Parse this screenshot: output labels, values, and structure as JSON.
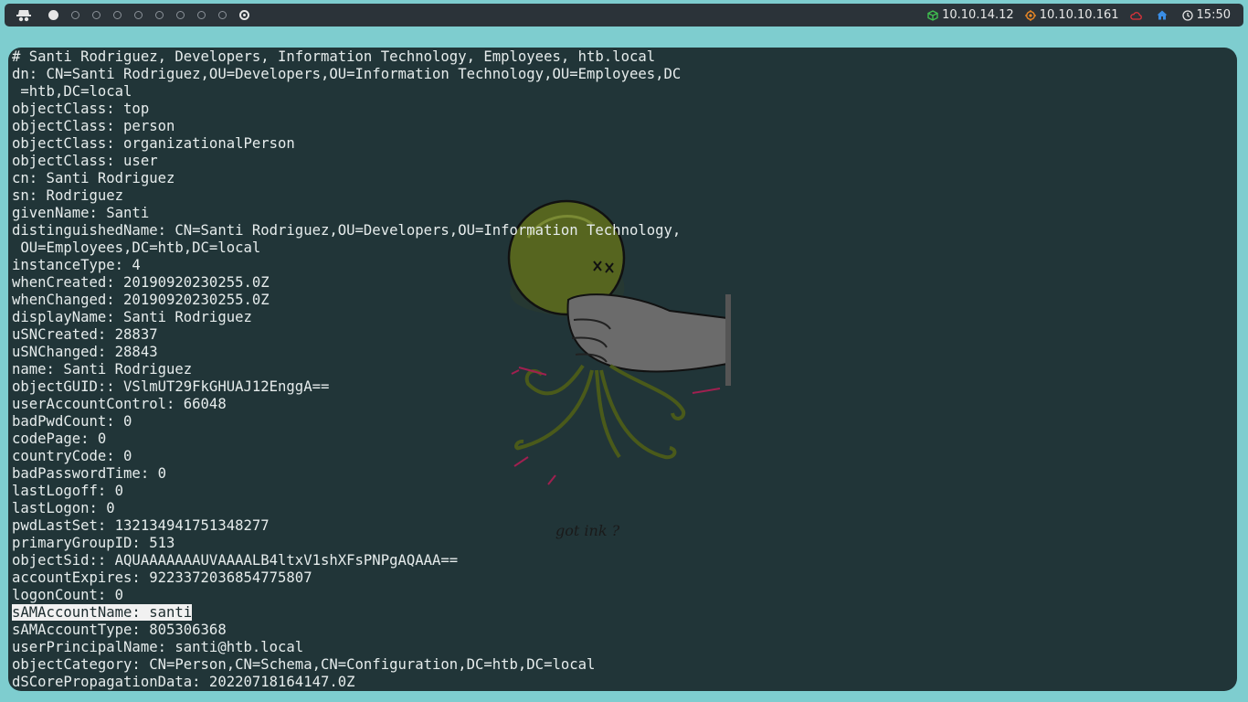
{
  "topbar": {
    "workspaces": [
      "1",
      "2",
      "3",
      "4",
      "5",
      "6",
      "7",
      "8",
      "9",
      "10"
    ],
    "active_workspace": 0,
    "status": {
      "vpn_ip": "10.10.14.12",
      "target_ip": "10.10.10.161",
      "time": "15:50"
    },
    "colors": {
      "vpn": "#3fbf4f",
      "target": "#f08a24",
      "cloud": "#e0323a",
      "home": "#3a8ee6"
    }
  },
  "terminal": {
    "lines": [
      "# Santi Rodriguez, Developers, Information Technology, Employees, htb.local",
      "dn: CN=Santi Rodriguez,OU=Developers,OU=Information Technology,OU=Employees,DC",
      " =htb,DC=local",
      "objectClass: top",
      "objectClass: person",
      "objectClass: organizationalPerson",
      "objectClass: user",
      "cn: Santi Rodriguez",
      "sn: Rodriguez",
      "givenName: Santi",
      "distinguishedName: CN=Santi Rodriguez,OU=Developers,OU=Information Technology,",
      " OU=Employees,DC=htb,DC=local",
      "instanceType: 4",
      "whenCreated: 20190920230255.0Z",
      "whenChanged: 20190920230255.0Z",
      "displayName: Santi Rodriguez",
      "uSNCreated: 28837",
      "uSNChanged: 28843",
      "name: Santi Rodriguez",
      "objectGUID:: VSlmUT29FkGHUAJ12EnggA==",
      "userAccountControl: 66048",
      "badPwdCount: 0",
      "codePage: 0",
      "countryCode: 0",
      "badPasswordTime: 0",
      "lastLogoff: 0",
      "lastLogon: 0",
      "pwdLastSet: 132134941751348277",
      "primaryGroupID: 513",
      "objectSid:: AQUAAAAAAAUVAAAALB4ltxV1shXFsPNPgAQAAA==",
      "accountExpires: 9223372036854775807",
      "logonCount: 0",
      "sAMAccountName: santi",
      "sAMAccountType: 805306368",
      "userPrincipalName: santi@htb.local",
      "objectCategory: CN=Person,CN=Schema,CN=Configuration,DC=htb,DC=local",
      "dSCorePropagationData: 20220718164147.0Z"
    ],
    "highlighted_line": 32,
    "wallpaper_caption": "got ink ?"
  }
}
